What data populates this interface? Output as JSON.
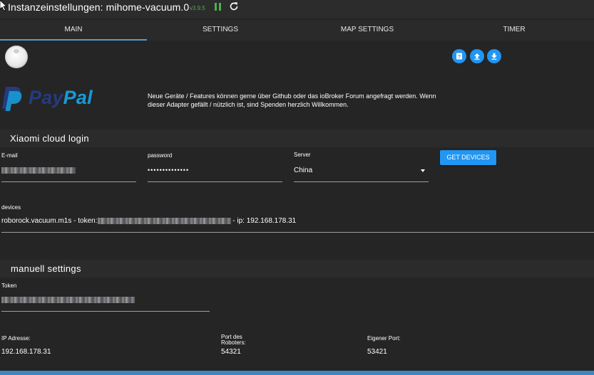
{
  "window": {
    "title": "Instanzeinstellungen: mihome-vacuum.0",
    "version": "v3.9.5"
  },
  "tabs": [
    {
      "label": "MAIN"
    },
    {
      "label": "SETTINGS"
    },
    {
      "label": "MAP SETTINGS"
    },
    {
      "label": "TIMER"
    }
  ],
  "toolbar": {
    "icons": [
      "help-icon",
      "upload-icon",
      "download-icon"
    ]
  },
  "paypal": {
    "word_pay": "Pay",
    "word_pal": "Pal",
    "colors": {
      "dark": "#253b80",
      "light": "#179bd7"
    }
  },
  "info": {
    "text": "Neue Geräte / Features können gerne über Github oder das ioBroker Forum angefragt werden. Wenn dieser Adapter gefällt / nützlich ist, sind Spenden herzlich Willkommen."
  },
  "cloud_login": {
    "title": "Xiaomi cloud login",
    "email_label": "E-mail",
    "password_label": "password",
    "password_value": "••••••••••••••",
    "server_label": "Server",
    "server_value": "China",
    "get_devices_label": "GET DEVICES"
  },
  "devices": {
    "label": "devices",
    "prefix": "roborock.vacuum.m1s - token:",
    "suffix": " - ip: 192.168.178.31"
  },
  "manual": {
    "title": "manuell settings",
    "token_label": "Token",
    "ip_label": "IP Adresse:",
    "ip_value": "192.168.178.31",
    "robot_port_label_1": "Port des",
    "robot_port_label_2": "Roboters:",
    "robot_port_value": "54321",
    "own_port_label": "Eigener Port:",
    "own_port_value": "53421"
  },
  "colors": {
    "accent": "#2196f3",
    "running": "#4caf50",
    "background": "#252525"
  }
}
